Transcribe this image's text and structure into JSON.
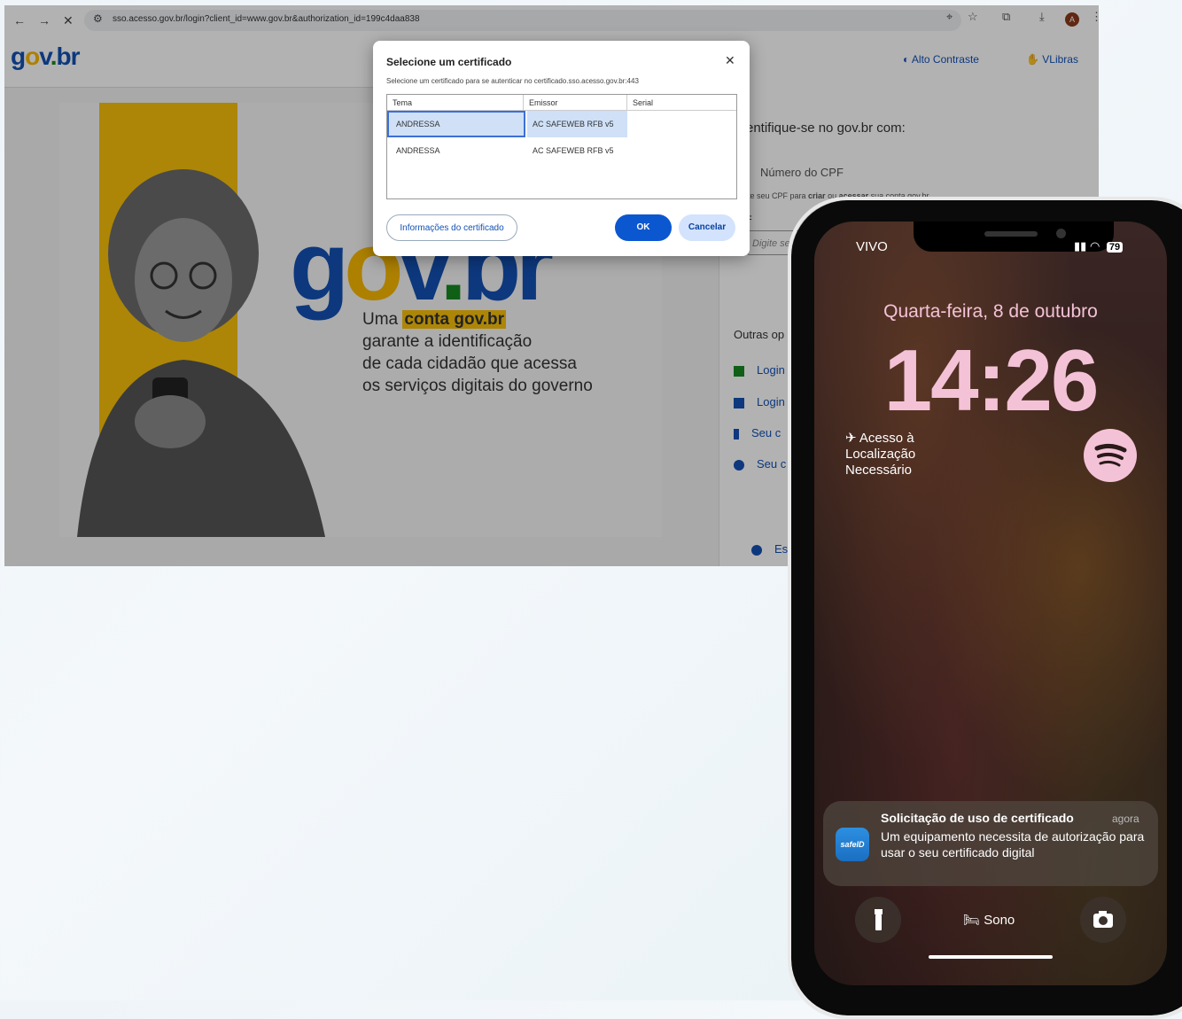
{
  "browser": {
    "url": "sso.acesso.gov.br/login?client_id=www.gov.br&authorization_id=199c4daa838",
    "profile_initial": "A"
  },
  "page": {
    "header": {
      "logo": {
        "g": "g",
        "o": "o",
        "v": "v",
        "dot": ".",
        "br": "br"
      },
      "high_contrast": "Alto Contraste",
      "vlibras": "VLibras"
    },
    "hero": {
      "tagline_prefix": "Uma ",
      "tagline_highlight": "conta gov.br",
      "tagline_lines": [
        "garante a identificação",
        "de cada cidadão que acessa",
        "os serviços digitais do governo"
      ]
    },
    "login": {
      "title": "entifique-se no gov.br com:",
      "cpf_option": "Número do CPF",
      "cpf_help_prefix": "ite seu CPF para ",
      "cpf_help_criar": "criar",
      "cpf_help_mid": " ou ",
      "cpf_help_acessar": "acessar",
      "cpf_help_suffix": " sua conta gov.br",
      "cpf_field_label": "F",
      "cpf_placeholder": "Digite seu",
      "outras": "Outras op",
      "options": [
        "Login",
        "Login",
        "Seu c",
        "Seu c"
      ],
      "footer_link": "Está"
    }
  },
  "dialog": {
    "title": "Selecione um certificado",
    "subtitle": "Selecione um certificado para se autenticar no certificado.sso.acesso.gov.br:443",
    "columns": [
      "Tema",
      "Emissor",
      "Serial"
    ],
    "rows": [
      {
        "tema": "ANDRESSA",
        "emissor": "AC SAFEWEB RFB v5",
        "serial": ""
      },
      {
        "tema": "ANDRESSA",
        "emissor": "AC SAFEWEB RFB v5",
        "serial": ""
      }
    ],
    "info_button": "Informações do certificado",
    "ok_button": "OK",
    "cancel_button": "Cancelar"
  },
  "phone": {
    "carrier": "VIVO",
    "battery": "79",
    "date": "Quarta-feira, 8 de outubro",
    "time": "14:26",
    "location_widget": [
      "Acesso à",
      "Localização",
      "Necessário"
    ],
    "notification": {
      "app_label": "safeID",
      "title": "Solicitação de uso de certificado",
      "time": "agora",
      "body": "Um equipamento necessita de autorização para usar o seu certificado digital"
    },
    "focus_mode": "Sono",
    "colors": {
      "clock": "#f4c2d6",
      "accent_blue": "#0b57d0",
      "govbr_blue": "#1351b4",
      "govbr_yellow": "#f8c10b"
    }
  }
}
